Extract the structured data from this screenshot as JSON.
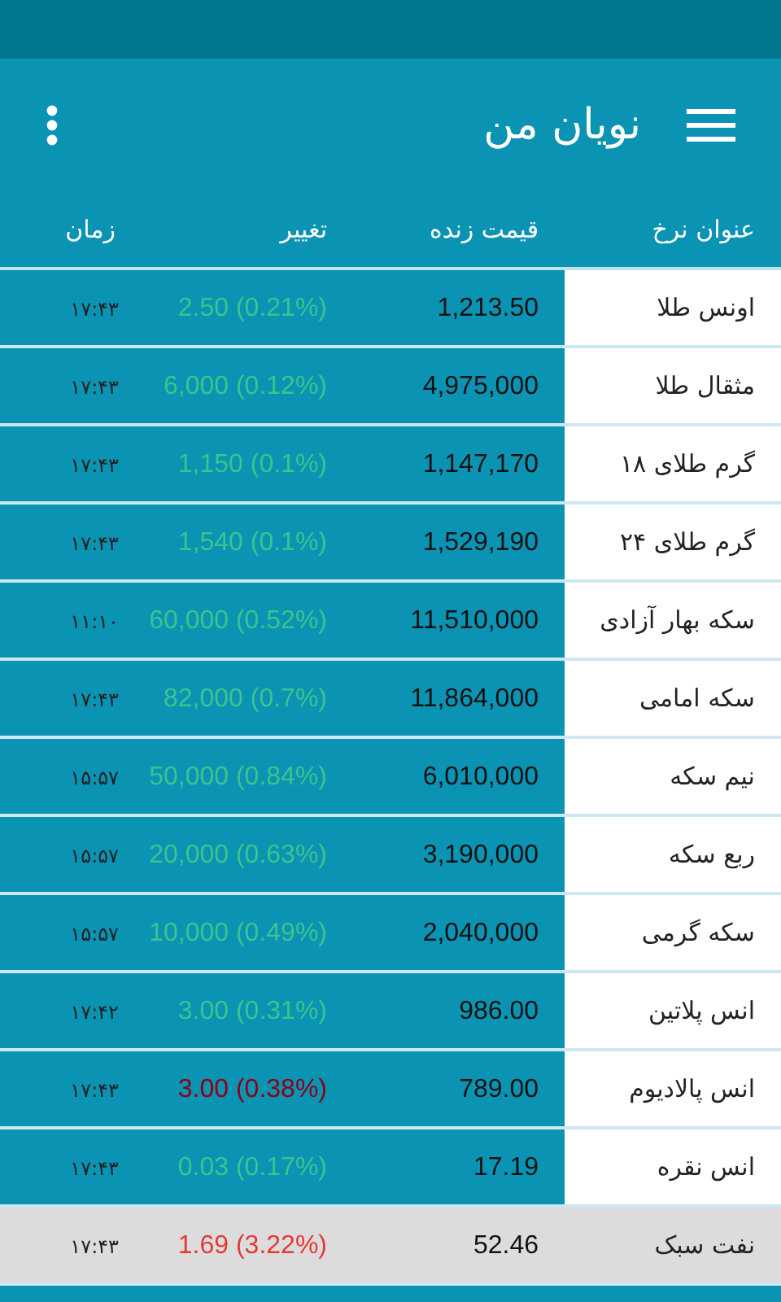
{
  "app_bar": {
    "title": "نویان من"
  },
  "table": {
    "columns": [
      "عنوان نرخ",
      "قیمت زنده",
      "تغییر",
      "زمان"
    ],
    "rows": [
      {
        "name": "اونس طلا",
        "price": "1,213.50",
        "change": "2.50 (0.21%)",
        "kind": "up",
        "time": "۱۷:۴۳",
        "selected": false
      },
      {
        "name": "مثقال طلا",
        "price": "4,975,000",
        "change": "6,000 (0.12%)",
        "kind": "up",
        "time": "۱۷:۴۳",
        "selected": false
      },
      {
        "name": "گرم طلای ۱۸",
        "price": "1,147,170",
        "change": "1,150 (0.1%)",
        "kind": "up",
        "time": "۱۷:۴۳",
        "selected": false
      },
      {
        "name": "گرم طلای ۲۴",
        "price": "1,529,190",
        "change": "1,540 (0.1%)",
        "kind": "up",
        "time": "۱۷:۴۳",
        "selected": false
      },
      {
        "name": "سکه بهار آزادی",
        "price": "11,510,000",
        "change": "60,000 (0.52%)",
        "kind": "up",
        "time": "۱۱:۱۰",
        "selected": false
      },
      {
        "name": "سکه امامی",
        "price": "11,864,000",
        "change": "82,000 (0.7%)",
        "kind": "up",
        "time": "۱۷:۴۳",
        "selected": false
      },
      {
        "name": "نیم سکه",
        "price": "6,010,000",
        "change": "50,000 (0.84%)",
        "kind": "up",
        "time": "۱۵:۵۷",
        "selected": false
      },
      {
        "name": "ربع سکه",
        "price": "3,190,000",
        "change": "20,000 (0.63%)",
        "kind": "up",
        "time": "۱۵:۵۷",
        "selected": false
      },
      {
        "name": "سکه گرمی",
        "price": "2,040,000",
        "change": "10,000 (0.49%)",
        "kind": "up",
        "time": "۱۵:۵۷",
        "selected": false
      },
      {
        "name": "انس پلاتین",
        "price": "986.00",
        "change": "3.00 (0.31%)",
        "kind": "up",
        "time": "۱۷:۴۲",
        "selected": false
      },
      {
        "name": "انس پالادیوم",
        "price": "789.00",
        "change": "3.00 (0.38%)",
        "kind": "down",
        "time": "۱۷:۴۳",
        "selected": false
      },
      {
        "name": "انس نقره",
        "price": "17.19",
        "change": "0.03 (0.17%)",
        "kind": "up",
        "time": "۱۷:۴۳",
        "selected": false
      },
      {
        "name": "نفت سبک",
        "price": "52.46",
        "change": "1.69 (3.22%)",
        "kind": "down",
        "time": "۱۷:۴۳",
        "selected": true
      }
    ]
  }
}
